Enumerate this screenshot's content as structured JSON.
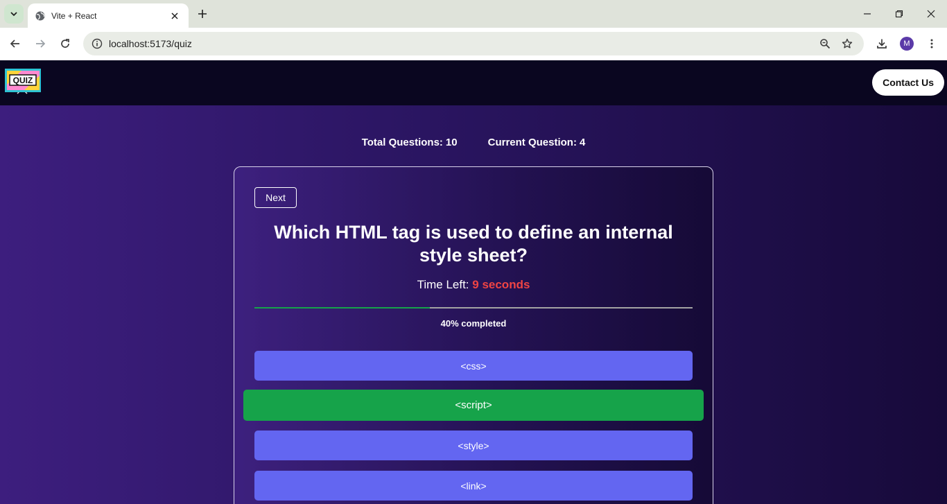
{
  "browser": {
    "tab_title": "Vite + React",
    "url_host": "localhost",
    "url_rest": ":5173/quiz",
    "profile_initial": "M"
  },
  "app": {
    "logo_text": "QUIZ",
    "contact_label": "Contact Us"
  },
  "quiz": {
    "total_label": "Total Questions:",
    "total_value": "10",
    "current_label": "Current Question:",
    "current_value": "4",
    "next_label": "Next",
    "question": "Which HTML tag is used to define an internal style sheet?",
    "time_label": "Time Left:",
    "time_value": "9 seconds",
    "progress_fraction": 0.4,
    "progress_label": "40% completed",
    "options": [
      {
        "label": "<css>",
        "selected": false
      },
      {
        "label": "<script>",
        "selected": true
      },
      {
        "label": "<style>",
        "selected": false
      },
      {
        "label": "<link>",
        "selected": false
      }
    ]
  },
  "colors": {
    "option": "#6366f1",
    "selected": "#16a34a",
    "timer": "#ef4444"
  }
}
